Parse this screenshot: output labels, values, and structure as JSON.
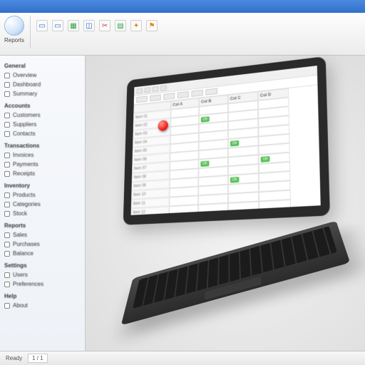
{
  "ribbon": {
    "main_label": "Reports",
    "icons": [
      "doc",
      "doc",
      "sheet",
      "chart",
      "cut",
      "table",
      "tool",
      "flag"
    ]
  },
  "sidebar": {
    "groups": [
      {
        "header": "General",
        "items": [
          "Overview",
          "Dashboard",
          "Summary"
        ]
      },
      {
        "header": "Accounts",
        "items": [
          "Customers",
          "Suppliers",
          "Contacts"
        ]
      },
      {
        "header": "Transactions",
        "items": [
          "Invoices",
          "Payments",
          "Receipts"
        ]
      },
      {
        "header": "Inventory",
        "items": [
          "Products",
          "Categories",
          "Stock"
        ]
      },
      {
        "header": "Reports",
        "items": [
          "Sales",
          "Purchases",
          "Balance"
        ]
      },
      {
        "header": "Settings",
        "items": [
          "Users",
          "Preferences"
        ]
      },
      {
        "header": "Help",
        "items": [
          "About"
        ]
      }
    ]
  },
  "laptop_screen": {
    "columns": [
      "",
      "Col A",
      "Col B",
      "Col C",
      "Col D"
    ],
    "rows": [
      "Item 01",
      "Item 02",
      "Item 03",
      "Item 04",
      "Item 05",
      "Item 06",
      "Item 07",
      "Item 08",
      "Item 09",
      "Item 10",
      "Item 11",
      "Item 12"
    ],
    "tag_label": "OK"
  },
  "statusbar": {
    "left": "Ready",
    "page": "1 / 1"
  }
}
